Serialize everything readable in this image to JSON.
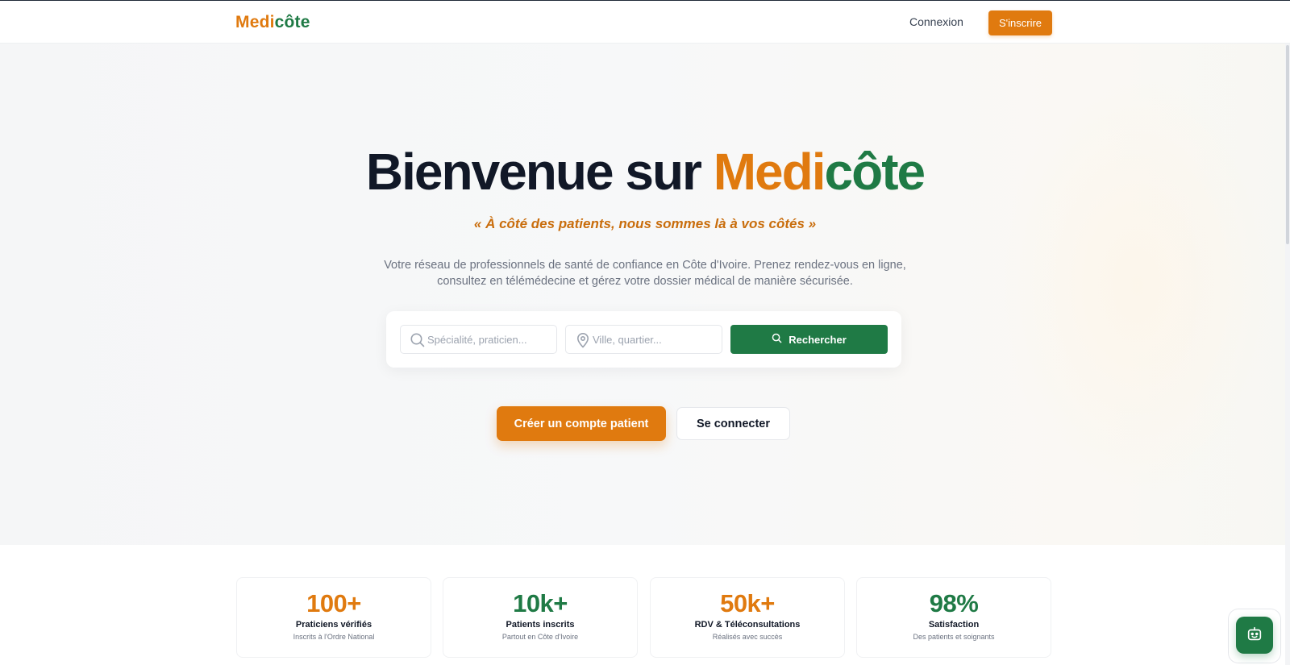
{
  "brand": {
    "part1": "Medi",
    "part2": "côte",
    "accent_orange": "#e07a0f",
    "accent_green": "#1f7a45"
  },
  "nav": {
    "login_label": "Connexion",
    "signup_label": "S'inscrire"
  },
  "hero": {
    "title_prefix": "Bienvenue sur ",
    "title_brand_part1": "Medi",
    "title_brand_part2": "côte",
    "tagline": "« À côté des patients, nous sommes là à vos côtés »",
    "description_line1": "Votre réseau de professionnels de santé de confiance en Côte d'Ivoire. Prenez rendez-vous en ligne,",
    "description_line2": "consultez en télémédecine et gérez votre dossier médical de manière sécurisée."
  },
  "search": {
    "specialty_placeholder": "Spécialité, praticien...",
    "location_placeholder": "Ville, quartier...",
    "button_label": "Rechercher",
    "specialty_icon": "search-icon",
    "location_icon": "map-pin-icon"
  },
  "cta": {
    "primary_label": "Créer un compte patient",
    "secondary_label": "Se connecter"
  },
  "stats": [
    {
      "value": "100+",
      "label": "Praticiens vérifiés",
      "sub": "Inscrits à l'Ordre National",
      "color": "orange"
    },
    {
      "value": "10k+",
      "label": "Patients inscrits",
      "sub": "Partout en Côte d'Ivoire",
      "color": "green"
    },
    {
      "value": "50k+",
      "label": "RDV & Téléconsultations",
      "sub": "Réalisés avec succès",
      "color": "orange"
    },
    {
      "value": "98%",
      "label": "Satisfaction",
      "sub": "Des patients et soignants",
      "color": "green"
    }
  ],
  "chat": {
    "icon": "chatbot-icon"
  }
}
